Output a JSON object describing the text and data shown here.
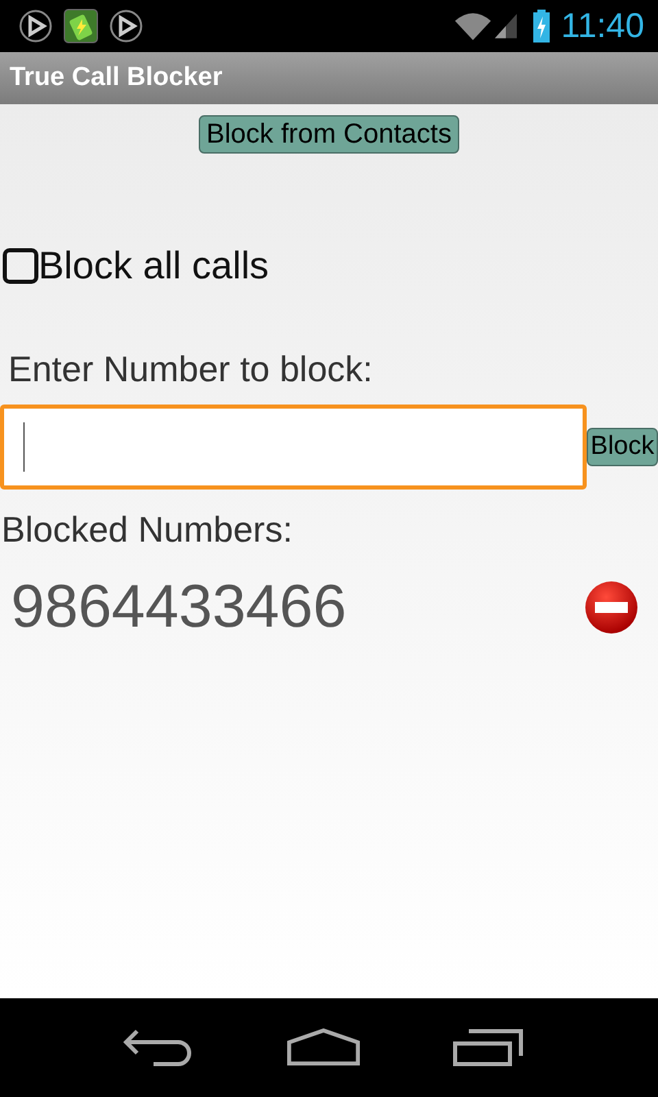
{
  "status_bar": {
    "time": "11:40"
  },
  "window": {
    "title": "True Call Blocker"
  },
  "contacts_button": "Block from Contacts",
  "block_all": {
    "label": "Block all calls",
    "checked": false
  },
  "number_entry": {
    "label": "Enter Number to block:",
    "focused": true,
    "button": "Block"
  },
  "blocked": {
    "heading": "Blocked Numbers:",
    "numbers": [
      {
        "number": "9864433466"
      }
    ]
  }
}
